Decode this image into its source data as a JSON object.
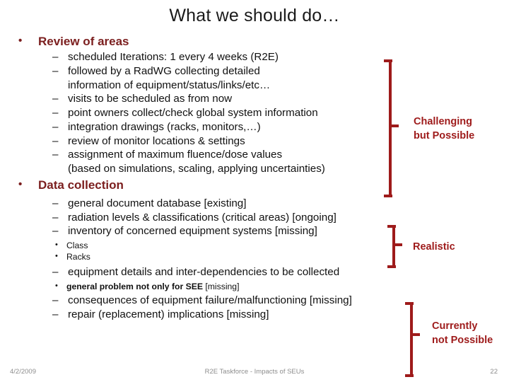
{
  "slide": {
    "title": "What we should do…",
    "page_number": "22",
    "accent_color": "#9E1B1B",
    "heading_color": "#7B1E1E",
    "body_color": "#111111"
  },
  "sections": [
    {
      "heading": "Review of areas",
      "bullet_glyph": "•",
      "items": [
        {
          "glyph": "–",
          "text": "scheduled Iterations: 1 every 4 weeks (R2E)"
        },
        {
          "glyph": "–",
          "text": "followed by a RadWG collecting detailed",
          "continuation": "information of equipment/status/links/etc…"
        },
        {
          "glyph": "–",
          "text": "visits to be scheduled as from now"
        },
        {
          "glyph": "–",
          "text": "point owners collect/check global system information"
        },
        {
          "glyph": "–",
          "text": "integration drawings (racks, monitors,…)"
        },
        {
          "glyph": "–",
          "text": "review of monitor locations & settings"
        },
        {
          "glyph": "–",
          "text": "assignment of maximum fluence/dose values",
          "continuation": "(based on simulations, scaling, applying uncertainties)"
        }
      ]
    },
    {
      "heading": "Data collection",
      "bullet_glyph": "•",
      "items": [
        {
          "glyph": "–",
          "text": "general document database [existing]"
        },
        {
          "glyph": "–",
          "text": "radiation levels & classifications (critical areas) [ongoing]"
        },
        {
          "glyph": "–",
          "text": "inventory of concerned equipment systems [missing]"
        }
      ],
      "subitems_a": [
        {
          "glyph": "•",
          "text": "Class"
        },
        {
          "glyph": "•",
          "text": "Racks"
        }
      ],
      "item_after_sub": {
        "glyph": "–",
        "text": "equipment details and inter-dependencies to be collected"
      },
      "subitems_b": [
        {
          "glyph": "•",
          "bold_text": "general problem not only for SEE",
          "tail_text": " [missing]"
        }
      ],
      "items_tail": [
        {
          "glyph": "–",
          "text": "consequences of equipment failure/malfunctioning [missing]"
        },
        {
          "glyph": "–",
          "text": "repair (replacement) implications [missing]"
        }
      ]
    }
  ],
  "annotations": [
    {
      "label_line1": "Challenging",
      "label_line2": "but Possible"
    },
    {
      "label_line1": "Realistic",
      "label_line2": ""
    },
    {
      "label_line1": "Currently",
      "label_line2": "not Possible"
    }
  ],
  "footer": {
    "date": "4/2/2009",
    "center": "R2E Taskforce - Impacts of SEUs",
    "page": "22"
  }
}
